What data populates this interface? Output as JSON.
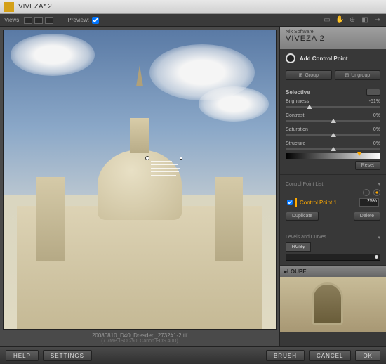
{
  "title": "VIVEZA* 2",
  "toolbar": {
    "views_label": "Views:",
    "preview_label": "Preview:"
  },
  "panel": {
    "maker": "Nik Software",
    "product": "VIVEZA 2",
    "add_cp": "Add Control Point",
    "group": "Group",
    "ungroup": "Ungroup",
    "selective": "Selective",
    "sliders": [
      {
        "name": "Brightness",
        "value": "-51%",
        "pos": 25
      },
      {
        "name": "Contrast",
        "value": "0%",
        "pos": 50
      },
      {
        "name": "Saturation",
        "value": "0%",
        "pos": 50
      },
      {
        "name": "Structure",
        "value": "0%",
        "pos": 50
      }
    ],
    "reset": "Reset",
    "cpl_label": "Control Point List",
    "cp_item": {
      "name": "Control Point 1",
      "pct": "25%"
    },
    "duplicate": "Duplicate",
    "delete": "Delete",
    "levels_curves": "Levels and Curves",
    "rgb": "RGB",
    "loupe": "LOUPE"
  },
  "file": {
    "name": "20080810_D40_Dresden_2732#1-2.tif",
    "meta": "(7.7MP, ISO 250, Canon EOS 40D)"
  },
  "footer": {
    "help": "HELP",
    "settings": "SETTINGS",
    "brush": "BRUSH",
    "cancel": "CANCEL",
    "ok": "OK"
  }
}
